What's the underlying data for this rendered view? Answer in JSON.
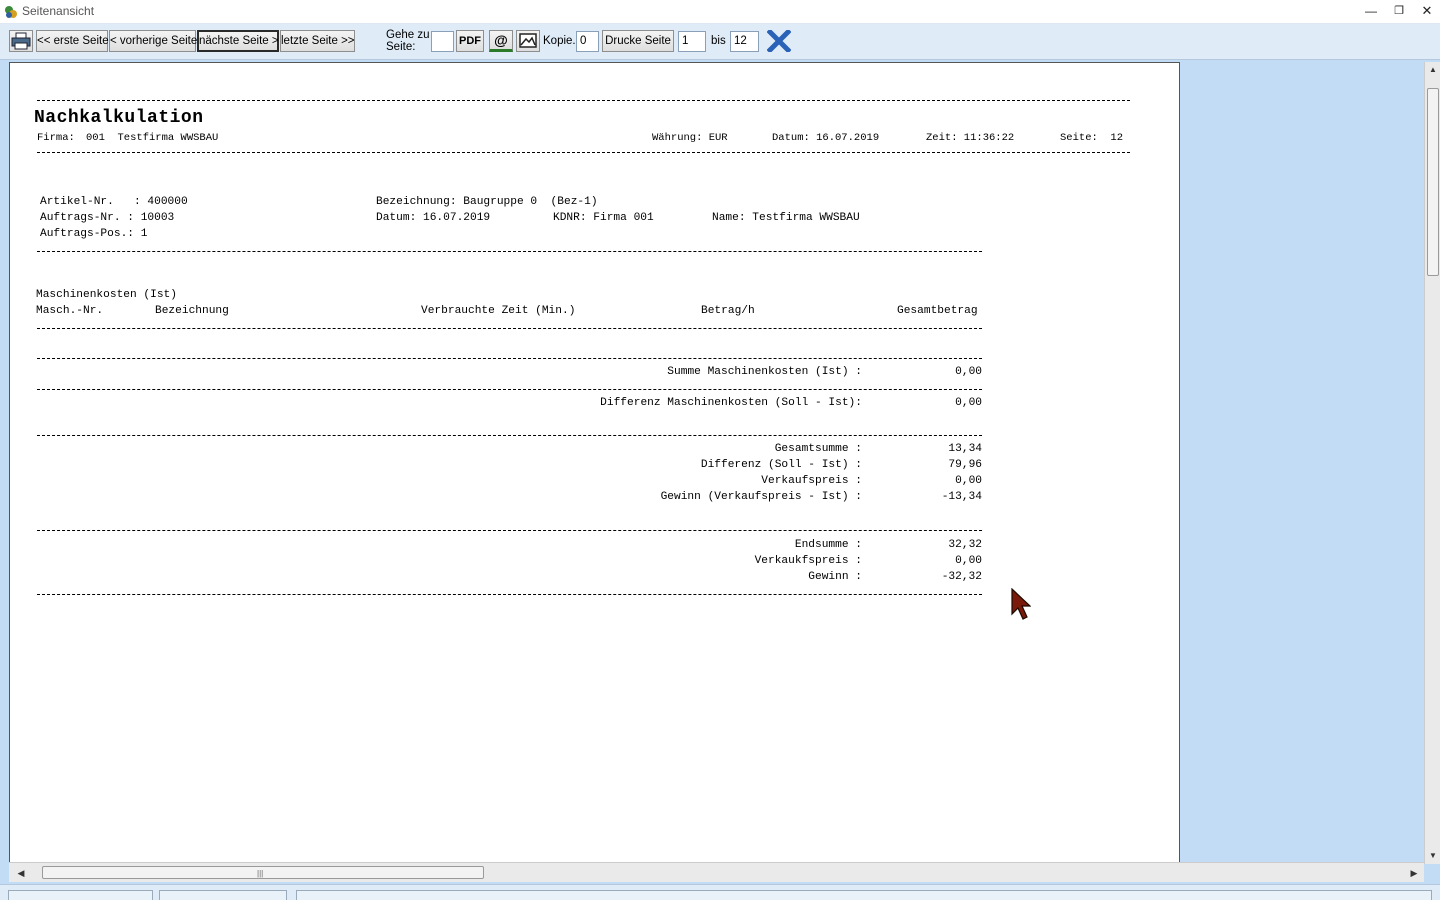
{
  "window": {
    "title": "Seitenansicht"
  },
  "toolbar": {
    "first_page": "<< erste Seite",
    "prev_page": "< vorherige Seite",
    "next_page": "nächste Seite >",
    "last_page": "letzte Seite >>",
    "goto_label_1": "Gehe zu",
    "goto_label_2": "Seite:",
    "goto_value": "",
    "pdf": "PDF",
    "email_icon": "@",
    "copies_label": "Kopie.:",
    "copies_value": "0",
    "print_page": "Drucke Seite",
    "from_value": "1",
    "bis_label": "bis",
    "to_value": "12"
  },
  "report": {
    "title": "Nachkalkulation",
    "firma_label": "Firma:",
    "firma_value": "001  Testfirma WWSBAU",
    "waehrung": "Währung: EUR",
    "datum": "Datum: 16.07.2019",
    "zeit": "Zeit: 11:36:22",
    "seite": "Seite:  12",
    "artikel": "Artikel-Nr.   : 400000",
    "auftrag": "Auftrags-Nr. : 10003",
    "auftrag_pos": "Auftrags-Pos.: 1",
    "bezeichnung": "Bezeichnung: Baugruppe 0  (Bez-1)",
    "datum2": "Datum: 16.07.2019",
    "kdnr": "KDNR: Firma 001",
    "name": "Name: Testfirma WWSBAU",
    "section": "Maschinenkosten (Ist)",
    "col_nr": "Masch.-Nr.",
    "col_bez": "Bezeichnung",
    "col_zeit": "Verbrauchte Zeit (Min.)",
    "col_betrag": "Betrag/h",
    "col_gesamt": "Gesamtbetrag",
    "summe_label": "Summe Maschinenkosten (Ist) :",
    "summe_value": "0,00",
    "diff_label": "Differenz Maschinenkosten (Soll - Ist):",
    "diff_value": "0,00",
    "totals": [
      {
        "label": "Gesamtsumme :",
        "value": "13,34"
      },
      {
        "label": "Differenz (Soll - Ist) :",
        "value": "79,96"
      },
      {
        "label": "Verkaufspreis :",
        "value": "0,00"
      },
      {
        "label": "Gewinn (Verkaufspreis - Ist) :",
        "value": "-13,34"
      }
    ],
    "end": [
      {
        "label": "Endsumme :",
        "value": "32,32"
      },
      {
        "label": "Verkaukfspreis :",
        "value": "0,00"
      },
      {
        "label": "Gewinn :",
        "value": "-32,32"
      }
    ]
  }
}
